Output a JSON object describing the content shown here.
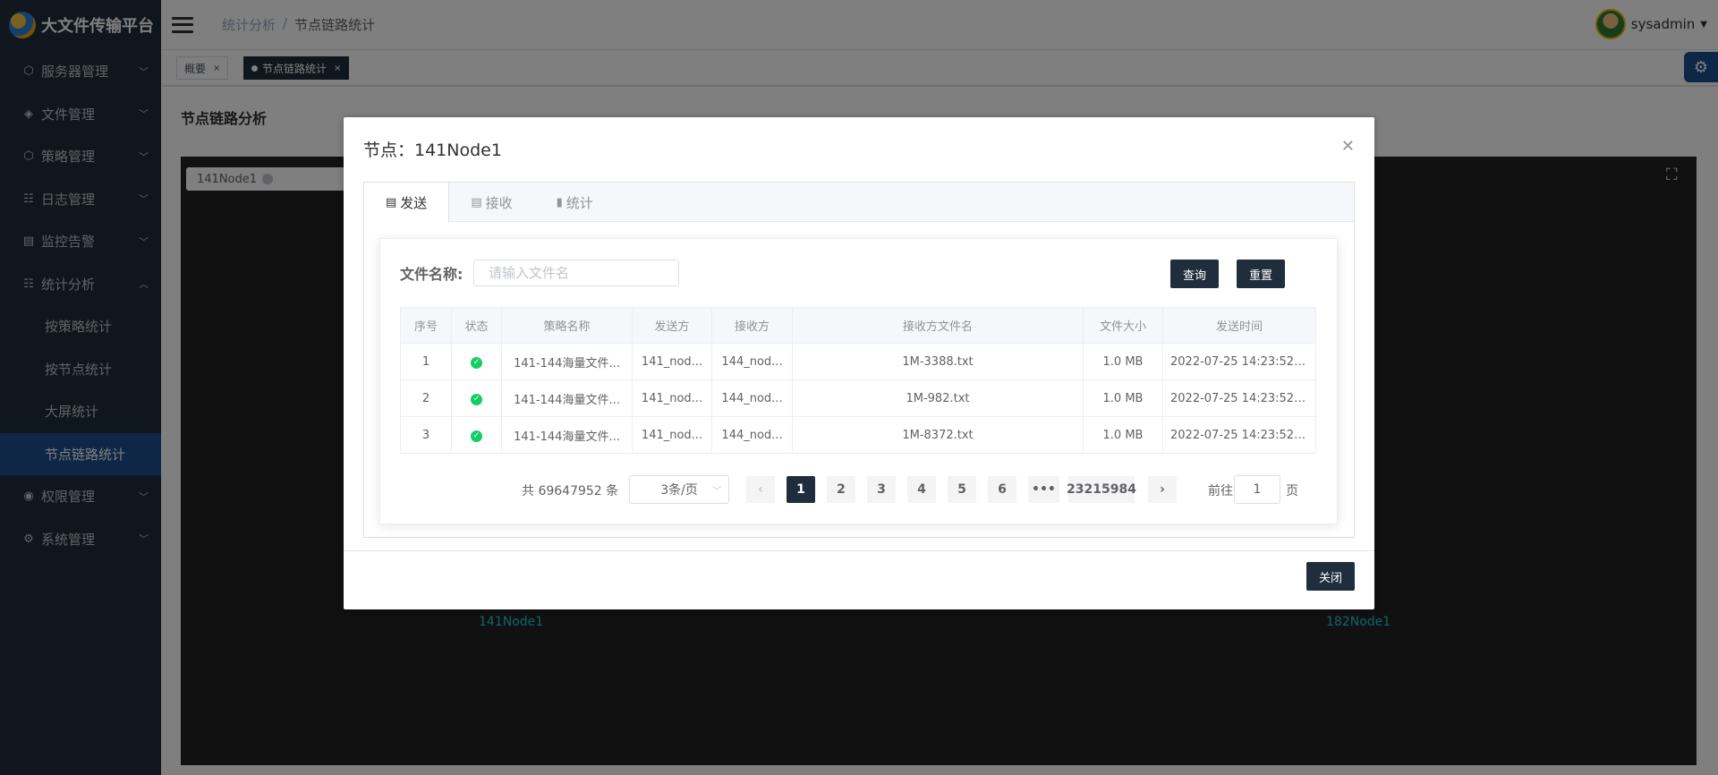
{
  "app": {
    "title": "大文件传输平台"
  },
  "sidebar": {
    "items": [
      {
        "label": "服务器管理",
        "icon": "server-icon",
        "expanded": false
      },
      {
        "label": "文件管理",
        "icon": "file-icon",
        "expanded": false
      },
      {
        "label": "策略管理",
        "icon": "policy-icon",
        "expanded": false
      },
      {
        "label": "日志管理",
        "icon": "log-icon",
        "expanded": false
      },
      {
        "label": "监控告警",
        "icon": "monitor-icon",
        "expanded": false
      },
      {
        "label": "统计分析",
        "icon": "stats-icon",
        "expanded": true
      },
      {
        "label": "权限管理",
        "icon": "permission-icon",
        "expanded": false
      },
      {
        "label": "系统管理",
        "icon": "system-icon",
        "expanded": false
      }
    ],
    "sub_items": [
      "按策略统计",
      "按节点统计",
      "大屏统计",
      "节点链路统计"
    ],
    "active_sub": "节点链路统计"
  },
  "header": {
    "breadcrumb": [
      "统计分析",
      "节点链路统计"
    ],
    "separator": "/",
    "user": "sysadmin"
  },
  "tags": [
    {
      "label": "概要",
      "active": false
    },
    {
      "label": "节点链路统计",
      "active": true
    }
  ],
  "page": {
    "title": "节点链路分析",
    "node_select": "141Node1",
    "nodes": [
      "141Node1",
      "182Node1"
    ]
  },
  "dialog": {
    "title": "节点：141Node1",
    "tabs": [
      {
        "label": "发送",
        "icon": "doc-icon",
        "active": true
      },
      {
        "label": "接收",
        "icon": "doc-icon",
        "active": false
      },
      {
        "label": "统计",
        "icon": "bar-chart-icon",
        "active": false
      }
    ],
    "search": {
      "label": "文件名称:",
      "placeholder": "请输入文件名",
      "value": "",
      "query_button": "查询",
      "reset_button": "重置"
    },
    "table": {
      "columns": [
        "序号",
        "状态",
        "策略名称",
        "发送方",
        "接收方",
        "接收方文件名",
        "文件大小",
        "发送时间"
      ],
      "rows": [
        {
          "index": "1",
          "status": "success",
          "policy": "141-144海量文件...",
          "sender": "141_nod...",
          "receiver": "144_nod...",
          "filename": "1M-3388.txt",
          "size": "1.0 MB",
          "time": "2022-07-25 14:23:52...."
        },
        {
          "index": "2",
          "status": "success",
          "policy": "141-144海量文件...",
          "sender": "141_nod...",
          "receiver": "144_nod...",
          "filename": "1M-982.txt",
          "size": "1.0 MB",
          "time": "2022-07-25 14:23:52...."
        },
        {
          "index": "3",
          "status": "success",
          "policy": "141-144海量文件...",
          "sender": "141_nod...",
          "receiver": "144_nod...",
          "filename": "1M-8372.txt",
          "size": "1.0 MB",
          "time": "2022-07-25 14:23:52...."
        }
      ]
    },
    "pagination": {
      "total": "共 69647952 条",
      "page_size": "3条/页",
      "pages": [
        "1",
        "2",
        "3",
        "4",
        "5",
        "6"
      ],
      "ellipsis": "•••",
      "last_page": "23215984",
      "current": "1",
      "goto_prefix": "前往",
      "goto_value": "1",
      "goto_suffix": "页"
    },
    "close_button": "关闭"
  },
  "colors": {
    "sidebar_bg": "#1f2d3d",
    "accent": "#1f4e8c",
    "dark_button": "#1f2d3d",
    "success": "#13ce66",
    "node_label": "#1ec8d8"
  }
}
